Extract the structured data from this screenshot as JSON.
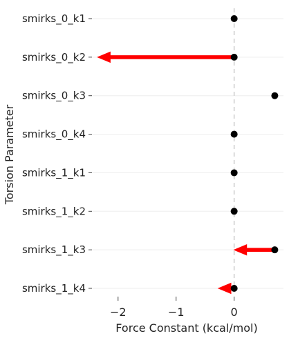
{
  "chart_data": {
    "type": "scatter",
    "xlabel": "Force Constant (kcal/mol)",
    "ylabel": "Torsion Parameter",
    "categories": [
      "smirks_0_k1",
      "smirks_0_k2",
      "smirks_0_k3",
      "smirks_0_k4",
      "smirks_1_k1",
      "smirks_1_k2",
      "smirks_1_k3",
      "smirks_1_k4"
    ],
    "xlim": [
      -2.45,
      0.85
    ],
    "xticks": [
      -2,
      -1,
      0
    ],
    "xtick_labels": [
      "−2",
      "−1",
      "0"
    ],
    "grid": "horizontal",
    "reference_line_x": 0,
    "points": [
      0.0,
      0.0,
      0.7,
      0.0,
      0.0,
      0.0,
      0.7,
      0.0
    ],
    "arrows": [
      {
        "category": "smirks_0_k2",
        "from": 0.0,
        "to": -2.35
      },
      {
        "category": "smirks_1_k3",
        "from": 0.7,
        "to": 0.0
      },
      {
        "category": "smirks_1_k4",
        "from": 0.0,
        "to": -0.27
      }
    ],
    "colors": {
      "point": "#000000",
      "arrow": "#ff0000",
      "grid": "#eeeeee",
      "refline": "#cccccc"
    }
  }
}
